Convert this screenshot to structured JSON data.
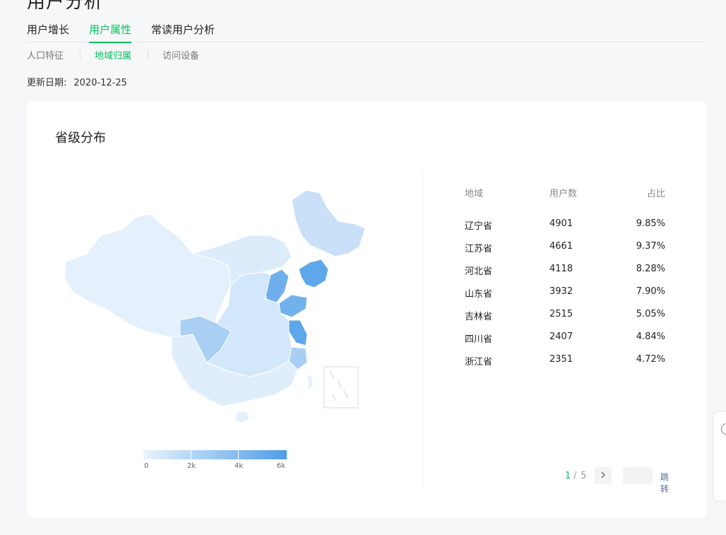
{
  "page": {
    "title": "用户分析"
  },
  "tabs": [
    {
      "label": "用户增长"
    },
    {
      "label": "用户属性"
    },
    {
      "label": "常读用户分析"
    }
  ],
  "subtabs": [
    {
      "label": "人口特征"
    },
    {
      "label": "地域归属"
    },
    {
      "label": "访问设备"
    }
  ],
  "update": {
    "label": "更新日期:",
    "value": "2020-12-25"
  },
  "card": {
    "title": "省级分布"
  },
  "legend": {
    "labels": [
      "0",
      "2k",
      "4k",
      "6k"
    ],
    "min_color": "#e9f3fd",
    "max_color": "#4e9de8"
  },
  "table": {
    "headers": [
      "地域",
      "用户数",
      "占比"
    ],
    "rows": [
      [
        "辽宁省",
        "4901",
        "9.85%"
      ],
      [
        "江苏省",
        "4661",
        "9.37%"
      ],
      [
        "河北省",
        "4118",
        "8.28%"
      ],
      [
        "山东省",
        "3932",
        "7.90%"
      ],
      [
        "吉林省",
        "2515",
        "5.05%"
      ],
      [
        "四川省",
        "2407",
        "4.84%"
      ],
      [
        "浙江省",
        "2351",
        "4.72%"
      ]
    ]
  },
  "pager": {
    "current": "1",
    "separator": "/",
    "total": "5",
    "next_icon": "chevron-right-icon",
    "jump_label": "跳转"
  },
  "colors": {
    "accent": "#07c160",
    "map_low": "#e4f0fc",
    "map_high": "#4e9de8"
  }
}
